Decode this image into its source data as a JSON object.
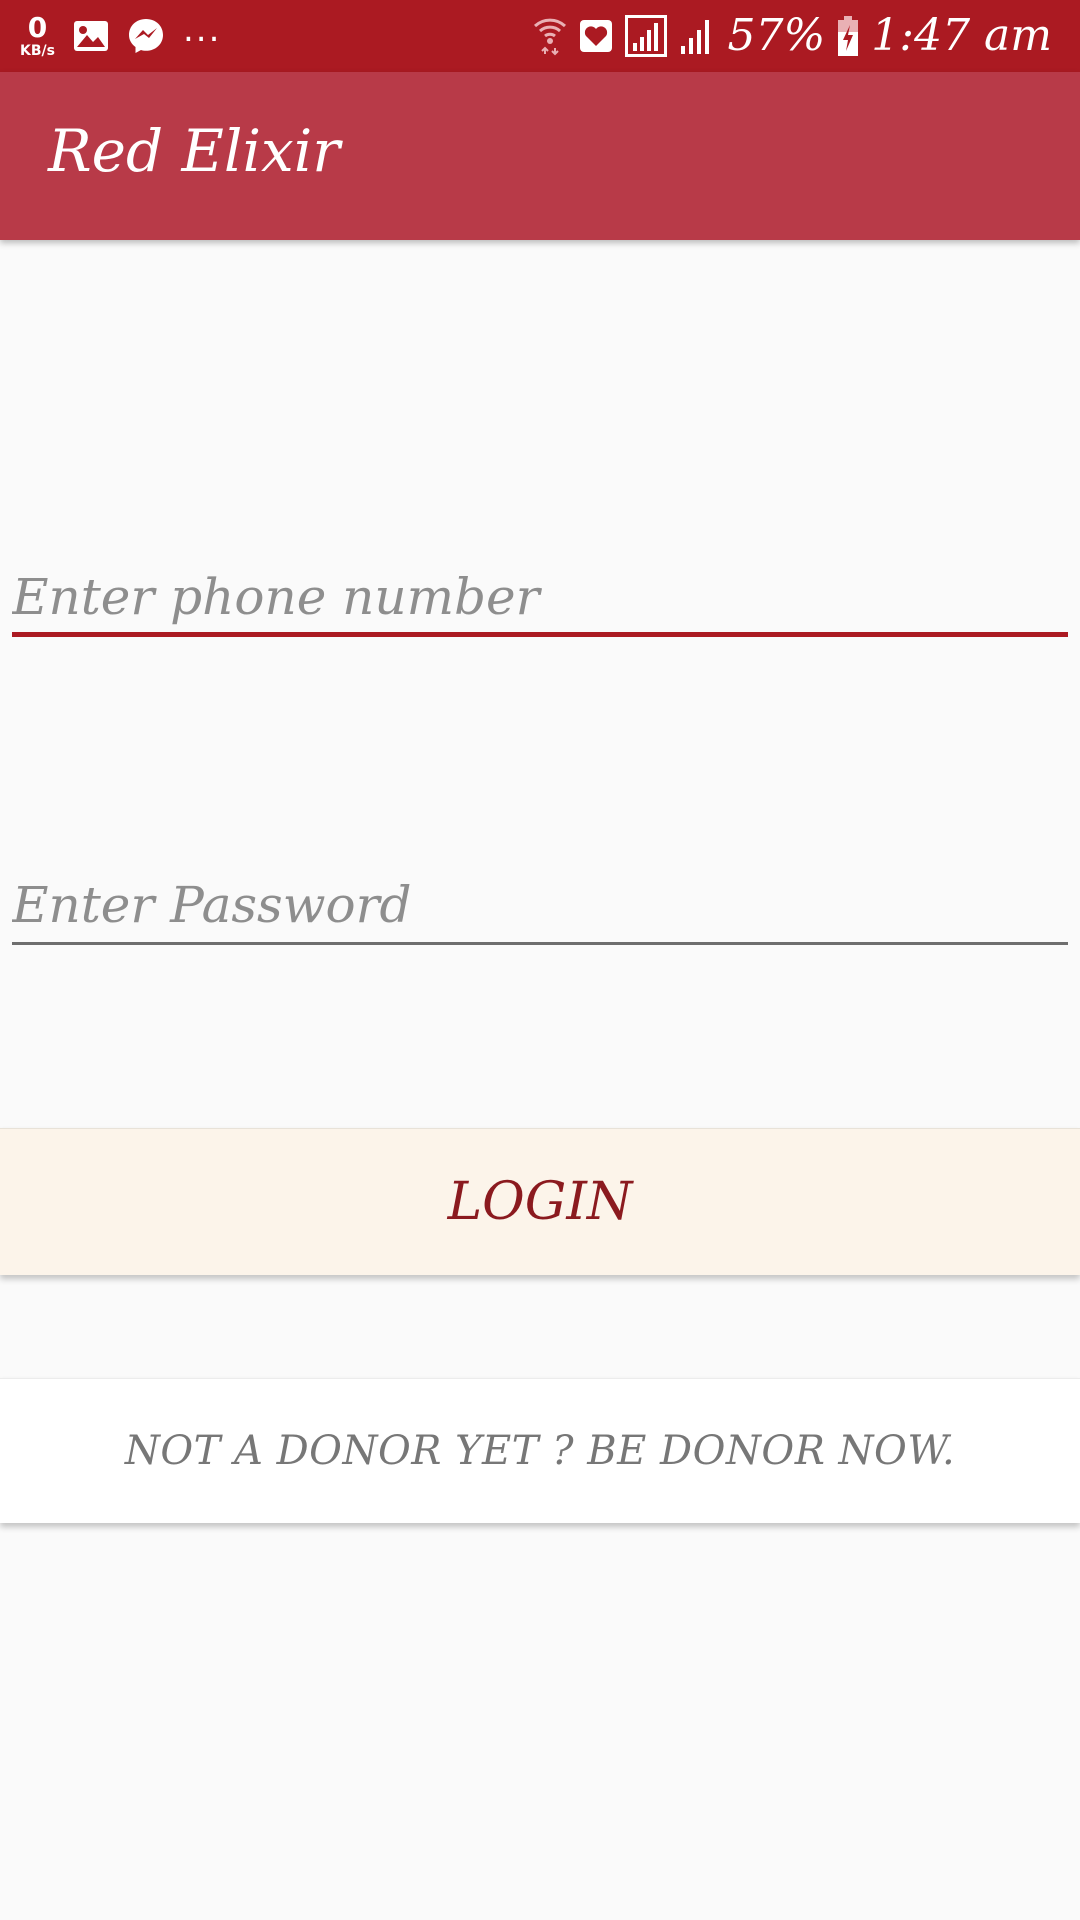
{
  "status_bar": {
    "speed_value": "0",
    "speed_unit": "KB/s",
    "overflow": "...",
    "battery": "57%",
    "time": "1:47 am",
    "icons": [
      "gallery-icon",
      "messenger-icon",
      "wifi-icon",
      "heart-notification-icon",
      "signal-icon",
      "signal-icon-2",
      "battery-charging-icon"
    ],
    "color": "#AB1A22"
  },
  "app_bar": {
    "title": "Red Elixir",
    "color": "#B83A48"
  },
  "form": {
    "phone_placeholder": "Enter phone number",
    "password_placeholder": "Enter Password",
    "accent_color": "#AB1A22"
  },
  "actions": {
    "login_label": "LOGIN",
    "register_label": "NOT A DONOR YET ? BE DONOR NOW."
  }
}
